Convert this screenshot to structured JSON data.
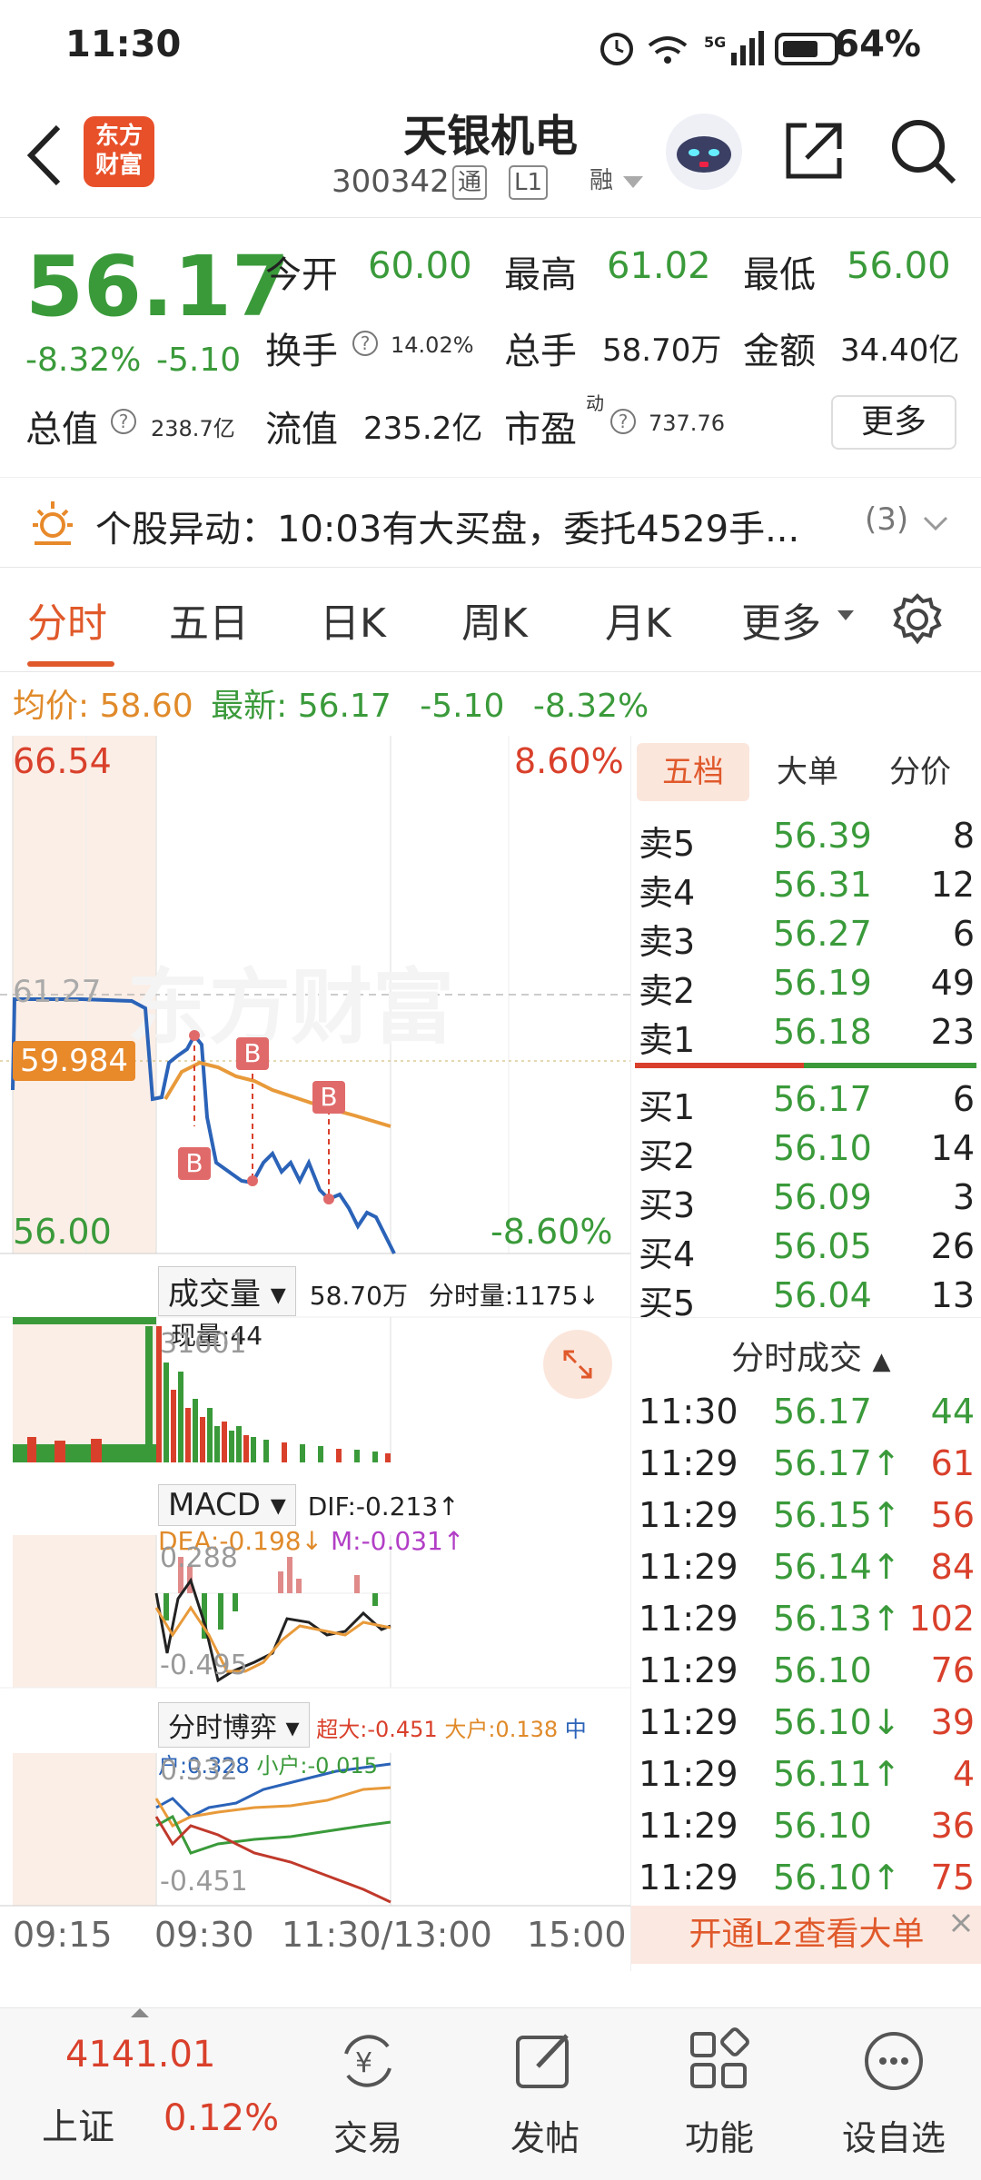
{
  "status_bar": {
    "time": "11:30",
    "battery": "64%",
    "network": "5G"
  },
  "header": {
    "title": "天银机电",
    "code": "300342",
    "tag_tong": "通",
    "tag_level": "L1",
    "tag_rong": "融",
    "logo_text": "东方财富"
  },
  "quote": {
    "price": "56.17",
    "change_pct": "-8.32%",
    "change": "-5.10",
    "open_label": "今开",
    "open": "60.00",
    "high_label": "最高",
    "high": "61.02",
    "low_label": "最低",
    "low": "56.00",
    "turnover_label": "换手",
    "turnover": "14.02%",
    "volume_label": "总手",
    "volume": "58.70万",
    "amount_label": "金额",
    "amount": "34.40亿",
    "mktcap_label": "总值",
    "mktcap": "238.7亿",
    "float_label": "流值",
    "float": "235.2亿",
    "pe_label": "市盈",
    "pe_sup": "动",
    "pe": "737.76",
    "more_button": "更多"
  },
  "alert": {
    "text": "个股异动：10:03有大买盘，委托4529手...",
    "count": "(3)"
  },
  "tabs": [
    "分时",
    "五日",
    "日K",
    "周K",
    "月K",
    "更多"
  ],
  "avg_bar": {
    "avg_label": "均价:",
    "avg": "58.60",
    "latest_label": "最新:",
    "latest": "56.17",
    "chg": "-5.10",
    "pct": "-8.32%"
  },
  "main_chart": {
    "y_top": "66.54",
    "y_top_pct": "8.60%",
    "y_bottom": "56.00",
    "y_bottom_pct": "-8.60%",
    "prev_close": "61.27",
    "cursor_price": "59.984",
    "marker": "B"
  },
  "volume_bar": {
    "label": "成交量",
    "total": "58.70万",
    "minute": "分时量:1175↓",
    "now": "现量:44",
    "peak": "31601"
  },
  "macd_bar": {
    "label": "MACD",
    "dif": "DIF:-0.213↑",
    "dea": "DEA:-0.198↓",
    "m": "M:-0.031↑",
    "top": "0.288",
    "bottom": "-0.495"
  },
  "game_bar": {
    "label": "分时博弈",
    "super": "超大:-0.451",
    "big": "大户:0.138",
    "mid": "中户:0.328",
    "small": "小户:-0.015",
    "top": "0.332",
    "bottom": "-0.451"
  },
  "time_axis": [
    "09:15",
    "09:30",
    "11:30/13:00",
    "15:00"
  ],
  "orderbook": {
    "tabs": [
      "五档",
      "大单",
      "分价"
    ],
    "asks": [
      {
        "label": "卖5",
        "price": "56.39",
        "vol": "8"
      },
      {
        "label": "卖4",
        "price": "56.31",
        "vol": "12"
      },
      {
        "label": "卖3",
        "price": "56.27",
        "vol": "6"
      },
      {
        "label": "卖2",
        "price": "56.19",
        "vol": "49"
      },
      {
        "label": "卖1",
        "price": "56.18",
        "vol": "23"
      }
    ],
    "bids": [
      {
        "label": "买1",
        "price": "56.17",
        "vol": "6"
      },
      {
        "label": "买2",
        "price": "56.10",
        "vol": "14"
      },
      {
        "label": "买3",
        "price": "56.09",
        "vol": "3"
      },
      {
        "label": "买4",
        "price": "56.05",
        "vol": "26"
      },
      {
        "label": "买5",
        "price": "56.04",
        "vol": "13"
      }
    ],
    "ticks_title": "分时成交",
    "ticks": [
      {
        "time": "11:30",
        "price": "56.17",
        "vol": "44",
        "dir": ""
      },
      {
        "time": "11:29",
        "price": "56.17↑",
        "vol": "61",
        "dir": "up"
      },
      {
        "time": "11:29",
        "price": "56.15↑",
        "vol": "56",
        "dir": "up"
      },
      {
        "time": "11:29",
        "price": "56.14↑",
        "vol": "84",
        "dir": "up"
      },
      {
        "time": "11:29",
        "price": "56.13↑",
        "vol": "102",
        "dir": "up"
      },
      {
        "time": "11:29",
        "price": "56.10",
        "vol": "76",
        "dir": "up"
      },
      {
        "time": "11:29",
        "price": "56.10↓",
        "vol": "39",
        "dir": "up"
      },
      {
        "time": "11:29",
        "price": "56.11↑",
        "vol": "4",
        "dir": "up"
      },
      {
        "time": "11:29",
        "price": "56.10",
        "vol": "36",
        "dir": "up"
      },
      {
        "time": "11:29",
        "price": "56.10↑",
        "vol": "75",
        "dir": "up"
      }
    ],
    "l2_banner": "开通L2查看大单"
  },
  "bottom_nav": {
    "index_value": "4141.01",
    "index_name": "上证",
    "index_pct": "0.12%",
    "items": [
      "交易",
      "发帖",
      "功能",
      "设自选"
    ]
  }
}
